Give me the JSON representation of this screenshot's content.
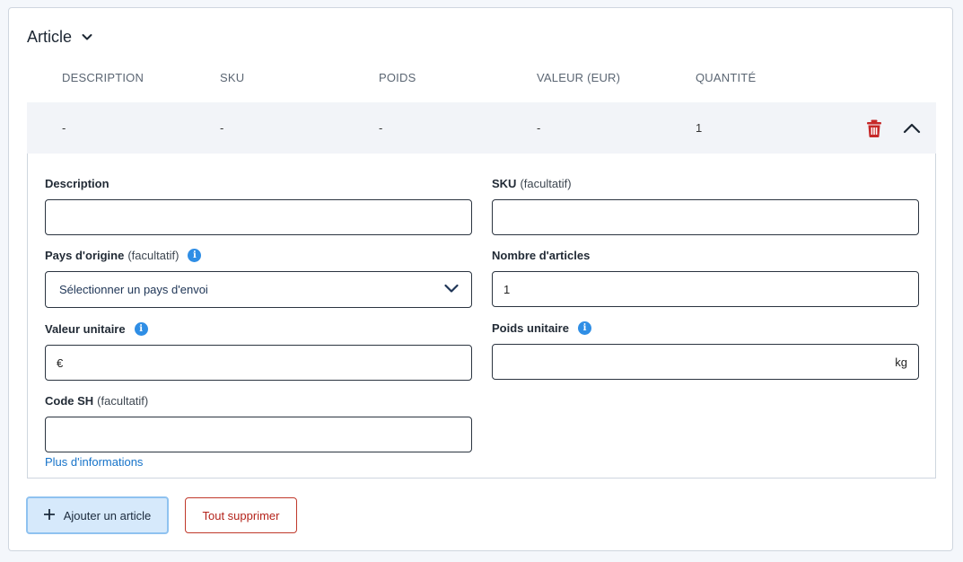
{
  "section": {
    "title": "Article"
  },
  "table": {
    "headers": [
      "DESCRIPTION",
      "SKU",
      "POIDS",
      "VALEUR (EUR)",
      "QUANTITÉ"
    ],
    "row": [
      "-",
      "-",
      "-",
      "-",
      "1"
    ]
  },
  "form": {
    "description_label": "Description",
    "sku_label": "SKU",
    "sku_optional": "(facultatif)",
    "origin_label": "Pays d'origine",
    "origin_optional": "(facultatif)",
    "origin_select": "Sélectionner un pays d'envoi",
    "count_label": "Nombre d'articles",
    "count_value": "1",
    "unit_value_label": "Valeur unitaire",
    "currency_symbol": "€",
    "unit_weight_label": "Poids unitaire",
    "weight_unit": "kg",
    "hs_label": "Code SH",
    "hs_optional": "(facultatif)",
    "more_info_link": "Plus d'informations"
  },
  "actions": {
    "add_label": "Ajouter un article",
    "delete_all_label": "Tout supprimer"
  },
  "colors": {
    "accent": "#2f8ee5",
    "danger": "#c62828",
    "row_bg": "#f2f4f8",
    "add_bg": "#d6e9fb"
  },
  "icons": [
    "chevron-down-icon",
    "trash-icon",
    "chevron-up-icon",
    "info-icon",
    "plus-icon"
  ]
}
